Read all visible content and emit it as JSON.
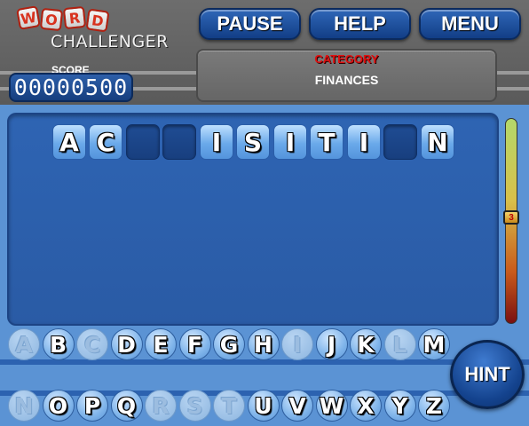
{
  "logo": {
    "tiles": [
      "W",
      "O",
      "R",
      "D"
    ],
    "subtitle": "CHALLENGER"
  },
  "toolbar": {
    "pause_label": "PAUSE",
    "help_label": "HELP",
    "menu_label": "MENU"
  },
  "score": {
    "label": "SCORE",
    "value": "00000500"
  },
  "category": {
    "title": "CATEGORY",
    "value": "FINANCES"
  },
  "puzzle": {
    "slots": [
      "A",
      "C",
      "",
      "",
      "I",
      "S",
      "I",
      "T",
      "I",
      "",
      "N"
    ]
  },
  "meter": {
    "value": "3"
  },
  "keyboard": {
    "row1": [
      {
        "letter": "A",
        "used": true
      },
      {
        "letter": "B",
        "used": false
      },
      {
        "letter": "C",
        "used": true
      },
      {
        "letter": "D",
        "used": false
      },
      {
        "letter": "E",
        "used": false
      },
      {
        "letter": "F",
        "used": false
      },
      {
        "letter": "G",
        "used": false
      },
      {
        "letter": "H",
        "used": false
      },
      {
        "letter": "I",
        "used": true
      },
      {
        "letter": "J",
        "used": false
      },
      {
        "letter": "K",
        "used": false
      },
      {
        "letter": "L",
        "used": true
      },
      {
        "letter": "M",
        "used": false
      }
    ],
    "row2": [
      {
        "letter": "N",
        "used": true
      },
      {
        "letter": "O",
        "used": false
      },
      {
        "letter": "P",
        "used": false
      },
      {
        "letter": "Q",
        "used": false
      },
      {
        "letter": "R",
        "used": true
      },
      {
        "letter": "S",
        "used": true
      },
      {
        "letter": "T",
        "used": true
      },
      {
        "letter": "U",
        "used": false
      },
      {
        "letter": "V",
        "used": false
      },
      {
        "letter": "W",
        "used": false
      },
      {
        "letter": "X",
        "used": false
      },
      {
        "letter": "Y",
        "used": false
      },
      {
        "letter": "Z",
        "used": false
      }
    ]
  },
  "hint": {
    "label": "HINT"
  },
  "colors": {
    "background": "#5b93d4",
    "header": "#626262",
    "button_blue": "#1f51a0",
    "category_red": "#e01010"
  }
}
